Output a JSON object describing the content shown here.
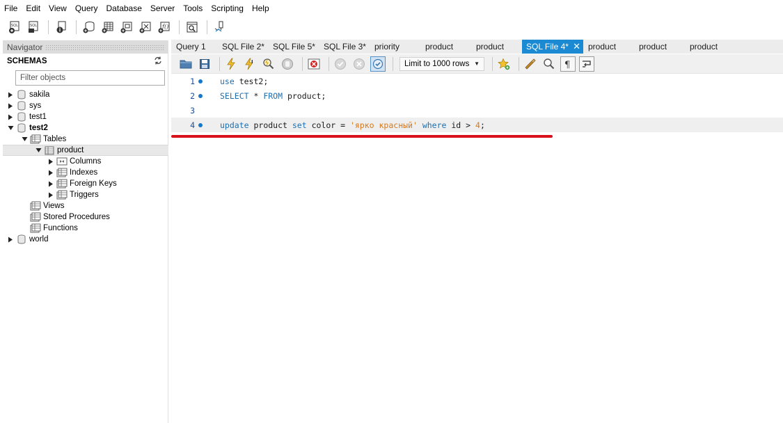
{
  "menu": [
    "File",
    "Edit",
    "View",
    "Query",
    "Database",
    "Server",
    "Tools",
    "Scripting",
    "Help"
  ],
  "main_toolbar": {
    "icons": [
      "new-sql-tab-icon",
      "open-sql-script-icon",
      "inspector-icon",
      "create-schema-icon",
      "create-table-icon",
      "create-view-icon",
      "create-procedure-icon",
      "create-function-icon",
      "search-table-data-icon",
      "reconnect-icon"
    ]
  },
  "navigator": {
    "title": "Navigator",
    "schemas_label": "SCHEMAS",
    "filter_placeholder": "Filter objects",
    "tree": {
      "sakila": "sakila",
      "sys": "sys",
      "test1": "test1",
      "test2": "test2",
      "tables": "Tables",
      "product": "product",
      "columns": "Columns",
      "indexes": "Indexes",
      "foreign_keys": "Foreign Keys",
      "triggers": "Triggers",
      "views": "Views",
      "stored_procedures": "Stored Procedures",
      "functions": "Functions",
      "world": "world"
    }
  },
  "tabs": [
    {
      "label": "Query 1"
    },
    {
      "label": "SQL File 2*"
    },
    {
      "label": "SQL File 5*"
    },
    {
      "label": "SQL File 3*"
    },
    {
      "label": "priority"
    },
    {
      "label": "product"
    },
    {
      "label": "product"
    },
    {
      "label": "SQL File 4*",
      "active": true
    },
    {
      "label": "product"
    },
    {
      "label": "product"
    },
    {
      "label": "product"
    }
  ],
  "sql_toolbar": {
    "limit_select": "Limit to 1000 rows"
  },
  "editor": {
    "lines": [
      {
        "num": "1",
        "tokens": [
          {
            "t": "use",
            "c": "kw"
          },
          {
            "t": " test2;",
            "c": ""
          }
        ]
      },
      {
        "num": "2",
        "tokens": [
          {
            "t": "SELECT",
            "c": "kw"
          },
          {
            "t": " * ",
            "c": ""
          },
          {
            "t": "FROM",
            "c": "kw"
          },
          {
            "t": " product;",
            "c": ""
          }
        ]
      },
      {
        "num": "3",
        "tokens": []
      },
      {
        "num": "4",
        "tokens": [
          {
            "t": "update",
            "c": "kw"
          },
          {
            "t": " product ",
            "c": ""
          },
          {
            "t": "set",
            "c": "kw"
          },
          {
            "t": " color = ",
            "c": ""
          },
          {
            "t": "'ярко красный'",
            "c": "str"
          },
          {
            "t": " ",
            "c": ""
          },
          {
            "t": "where",
            "c": "kw"
          },
          {
            "t": " id > ",
            "c": ""
          },
          {
            "t": "4",
            "c": "num"
          },
          {
            "t": ";",
            "c": ""
          }
        ]
      }
    ]
  },
  "colors": {
    "active_tab": "#1b8ad3",
    "keyword": "#1e6fb0",
    "string": "#d8781a",
    "annotation_underline": "#d9111b"
  }
}
